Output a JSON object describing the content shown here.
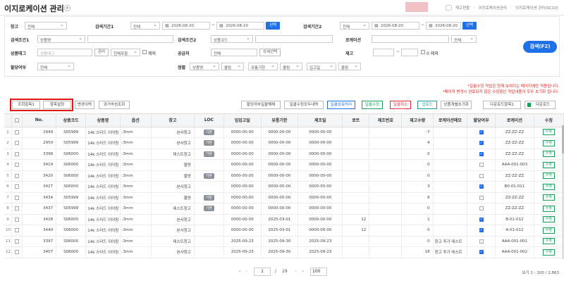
{
  "header": {
    "title": "이지로케이션 관리",
    "breadcrumb": [
      "재고현황",
      "이지로케이션관리",
      "이지로케이션 관리(SC10)"
    ]
  },
  "search": {
    "warehouse_label": "창고",
    "warehouse_value": "전체",
    "period1_label": "검색기간1",
    "period1_type": "전체",
    "period1_from": "2026-08-20",
    "period1_to": "2026-08-20",
    "period1_btn": "선택",
    "period2_label": "검색기간2",
    "period2_type": "전체",
    "period2_from": "2026-08-20",
    "period2_to": "2026-08-20",
    "period2_btn": "선택",
    "cond1_label": "검색조건1",
    "cond1_value": "상품명",
    "cond2_label": "검색조건2",
    "cond2_value": "상품코드",
    "location_label": "로케이션",
    "location_value": "전체",
    "tag_label": "상품태그",
    "tag_placeholder": "상품태그",
    "tag_btn": "관리",
    "tag_mode": "전체포함",
    "exclude_label": "제외",
    "supplier_label": "공급처",
    "supplier_value": "전체",
    "supplier_btn": "상세선택",
    "stock_label": "재고",
    "stock_sep": "~",
    "stock_zero_label": "0 제외",
    "assign_label": "할당여부",
    "assign_value": "전체",
    "sort_label": "정렬",
    "sort_items": [
      {
        "field": "상품명",
        "order": "올림"
      },
      {
        "field": "유통기한",
        "order": "올림"
      },
      {
        "field": "입고일",
        "order": "올림"
      }
    ],
    "search_btn": "검색(F2)"
  },
  "notices": [
    "*일괄수정 작업은 현재 보여지는 페이지에만 적용됩니다.",
    "*페이지 변경시 완료되지 않은 수정중인 작업내용이 모두 초기화 됩니다."
  ],
  "toolbar": {
    "view_item": "조회항목1",
    "item_setting": "항목설정",
    "change_history": "변경이력",
    "past_check": "과거속성조회",
    "assign_reset": "할당여부일괄해제",
    "bulk_edit_revert": "일괄수정모두내역",
    "bulk_done": "일괄완료처리",
    "bulk_edit": "일괄수정",
    "bulk_cancel": "일괄취소",
    "upload": "업로드",
    "product_reset": "상품개별초기화",
    "download_item": "다운로드항목1",
    "download": "다운로드"
  },
  "table": {
    "columns": [
      "No.",
      "상품코드",
      "상품명",
      "옵션",
      "창고",
      "LOC",
      "입입고일",
      "유통기한",
      "제조일",
      "로트",
      "제조번호",
      "재고수량",
      "로케이션메모",
      "할당여부",
      "로케이션",
      "수정"
    ],
    "rows": [
      {
        "idx": "1",
        "no": "2949",
        "code": "S05999",
        "name": "14k 스터드 이어링",
        "opt": ":3mm",
        "wh": "본사창고",
        "loc": "기본",
        "indate": "0000-00-00",
        "exp": "0000-00-00",
        "mfg": "0000-00-00",
        "lot": "",
        "serial": "",
        "qty": "-7",
        "memo": "",
        "assigned": true,
        "location": "ZZ-ZZ-ZZ",
        "edit": "수정"
      },
      {
        "idx": "2",
        "no": "2950",
        "code": "S05999",
        "name": "14k 스터드 이어링",
        "opt": ":3mm",
        "wh": "본사창고",
        "loc": "기본",
        "indate": "0000-00-00",
        "exp": "0000-00-00",
        "mfg": "0000-00-00",
        "lot": "",
        "serial": "",
        "qty": "4",
        "memo": "",
        "assigned": true,
        "location": "ZZ-ZZ-ZZ",
        "edit": "수정"
      },
      {
        "idx": "3",
        "no": "3398",
        "code": "S06000",
        "name": "14k 스터드 이어링",
        "opt": ":3mm",
        "wh": "테스트창고",
        "loc": "기본",
        "indate": "0000-00-00",
        "exp": "0000-00-00",
        "mfg": "0000-00-00",
        "lot": "",
        "serial": "",
        "qty": "0",
        "memo": "",
        "assigned": true,
        "location": "ZZ-ZZ-ZZ",
        "edit": "수정"
      },
      {
        "idx": "4",
        "no": "3419",
        "code": "S06000",
        "name": "14k 스터드 이어링",
        "opt": ":3mm",
        "wh": "불량",
        "loc": "",
        "indate": "0000-00-00",
        "exp": "0000-00-00",
        "mfg": "0000-00-00",
        "lot": "",
        "serial": "",
        "qty": "0",
        "memo": "",
        "assigned": false,
        "location": "AAA-001-003",
        "edit": "수정"
      },
      {
        "idx": "5",
        "no": "3420",
        "code": "S06000",
        "name": "14k 스터드 이어링",
        "opt": ":3mm",
        "wh": "불량",
        "loc": "기본",
        "indate": "0000-00-00",
        "exp": "0000-00-00",
        "mfg": "0000-00-00",
        "lot": "",
        "serial": "",
        "qty": "0",
        "memo": "",
        "assigned": false,
        "location": "ZZ-ZZ-ZZ",
        "edit": "수정"
      },
      {
        "idx": "6",
        "no": "3427",
        "code": "S06000",
        "name": "14k 스터드 이어링",
        "opt": ":3mm",
        "wh": "본사창고",
        "loc": "",
        "indate": "0000-00-00",
        "exp": "0000-00-00",
        "mfg": "0000-00-00",
        "lot": "",
        "serial": "",
        "qty": "3",
        "memo": "",
        "assigned": true,
        "location": "B0-01-011",
        "edit": "수정"
      },
      {
        "idx": "7",
        "no": "3434",
        "code": "S05999",
        "name": "14k 스터드 이어링",
        "opt": ":3mm",
        "wh": "불량",
        "loc": "기본",
        "indate": "0000-00-00",
        "exp": "0000-00-00",
        "mfg": "0000-00-00",
        "lot": "",
        "serial": "",
        "qty": "6",
        "memo": "",
        "assigned": false,
        "location": "ZZ-ZZ-ZZ",
        "edit": "수정"
      },
      {
        "idx": "8",
        "no": "3437",
        "code": "S05999",
        "name": "14k 스터드 이어링",
        "opt": ":3mm",
        "wh": "테스트창고",
        "loc": "기본",
        "indate": "0000-00-00",
        "exp": "0000-00-00",
        "mfg": "0000-00-00",
        "lot": "",
        "serial": "",
        "qty": "0",
        "memo": "",
        "assigned": false,
        "location": "ZZ-ZZ-ZZ",
        "edit": "수정"
      },
      {
        "idx": "9",
        "no": "3428",
        "code": "S06000",
        "name": "14k 스터드 이어링",
        "opt": ":3mm",
        "wh": "본사창고",
        "loc": "",
        "indate": "0000-00-00",
        "exp": "2025-03-01",
        "mfg": "0000-00-00",
        "lot": "12",
        "serial": "",
        "qty": "1",
        "memo": "",
        "assigned": true,
        "location": "B-01-012",
        "edit": "수정"
      },
      {
        "idx": "10",
        "no": "3440",
        "code": "S06000",
        "name": "14k 스터드 이어링",
        "opt": ":3mm",
        "wh": "본사창고",
        "loc": "",
        "indate": "0000-00-00",
        "exp": "2025-03-01",
        "mfg": "0000-00-00",
        "lot": "12",
        "serial": "",
        "qty": "0",
        "memo": "",
        "assigned": true,
        "location": "A-01-012",
        "edit": "수정"
      },
      {
        "idx": "11",
        "no": "3397",
        "code": "S06000",
        "name": "14k 스터드 이어링",
        "opt": ":3mm",
        "wh": "테스트창고",
        "loc": "",
        "indate": "2025-09-23",
        "exp": "2025-09-30",
        "mfg": "2025-09-23",
        "lot": "",
        "serial": "",
        "qty": "0",
        "memo": "창고 추가 테스트",
        "assigned": false,
        "location": "AAA-001-001",
        "edit": "수정"
      },
      {
        "idx": "12",
        "no": "3407",
        "code": "S06000",
        "name": "14k 스터드 이어링",
        "opt": ":3mm",
        "wh": "본사창고",
        "loc": "",
        "indate": "2025-09-23",
        "exp": "2025-09-30",
        "mfg": "2025-09-23",
        "lot": "",
        "serial": "",
        "qty": "18",
        "memo": "창고 추가 테스트",
        "assigned": true,
        "location": "AAA-001-002",
        "edit": "수정"
      }
    ]
  },
  "pager": {
    "first": "«",
    "prev": "‹",
    "current": "1",
    "slash": "/",
    "total_pages": "29",
    "next": "›",
    "last": "»",
    "per_page": "100",
    "summary": "보기 1 - 100 / 2,863"
  }
}
